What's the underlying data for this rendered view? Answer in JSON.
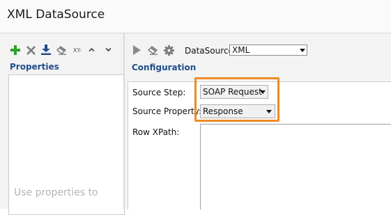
{
  "window": {
    "title": "XML DataSource"
  },
  "properties_panel": {
    "heading": "Properties",
    "hint": "Use properties to",
    "toolbar": [
      {
        "icon": "add-icon",
        "color": "#2ea02e"
      },
      {
        "icon": "delete-icon",
        "color": "#777777"
      },
      {
        "icon": "download-icon",
        "color": "#1f4e8c"
      },
      {
        "icon": "eraser-icon",
        "color": "#666666"
      },
      {
        "icon": "xy-icon",
        "label": "XY-"
      },
      {
        "icon": "chevron-up-icon"
      },
      {
        "icon": "chevron-down-icon"
      }
    ]
  },
  "config_panel": {
    "heading": "Configuration",
    "toolbar": [
      {
        "icon": "run-icon"
      },
      {
        "icon": "eraser-icon"
      },
      {
        "icon": "gear-icon"
      }
    ],
    "datasource": {
      "label": "DataSource:",
      "value": "XML"
    },
    "source_step": {
      "label": "Source Step:",
      "value": "SOAP Request"
    },
    "source_property": {
      "label": "Source Property:",
      "value": "Response"
    },
    "row_xpath": {
      "label": "Row XPath:",
      "value": ""
    }
  },
  "colors": {
    "accent_heading": "#1f4e8c",
    "highlight_border": "#f08a24"
  }
}
